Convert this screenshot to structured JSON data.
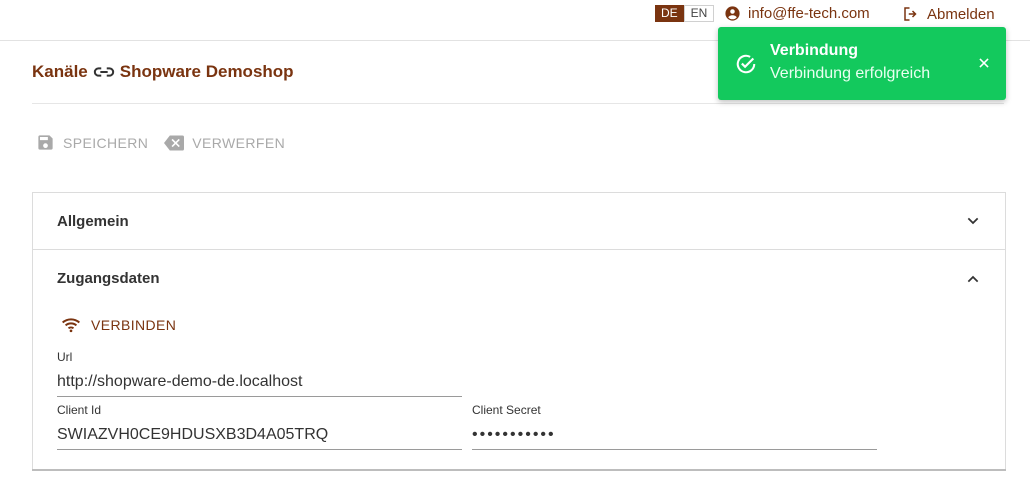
{
  "header": {
    "lang_active": "DE",
    "lang_inactive": "EN",
    "user_email": "info@ffe-tech.com",
    "logout_label": "Abmelden"
  },
  "breadcrumb": {
    "parent": "Kanäle",
    "current": "Shopware Demoshop",
    "separator_icon": "link-icon"
  },
  "toolbar": {
    "save_label": "SPEICHERN",
    "discard_label": "VERWERFEN"
  },
  "sections": {
    "general": {
      "title": "Allgemein",
      "expanded": false
    },
    "access": {
      "title": "Zugangsdaten",
      "expanded": true
    }
  },
  "access": {
    "connect_label": "VERBINDEN",
    "url_label": "Url",
    "url_value": "http://shopware-demo-de.localhost",
    "client_id_label": "Client Id",
    "client_id_value": "SWIAZVH0CE9HDUSXB3D4A05TRQ",
    "client_secret_label": "Client Secret",
    "client_secret_value": "•••••••••••"
  },
  "toast": {
    "title": "Verbindung",
    "message": "Verbindung erfolgreich",
    "color": "#13c95d"
  },
  "colors": {
    "accent": "#7a3410",
    "disabled": "#a9a9a9"
  }
}
